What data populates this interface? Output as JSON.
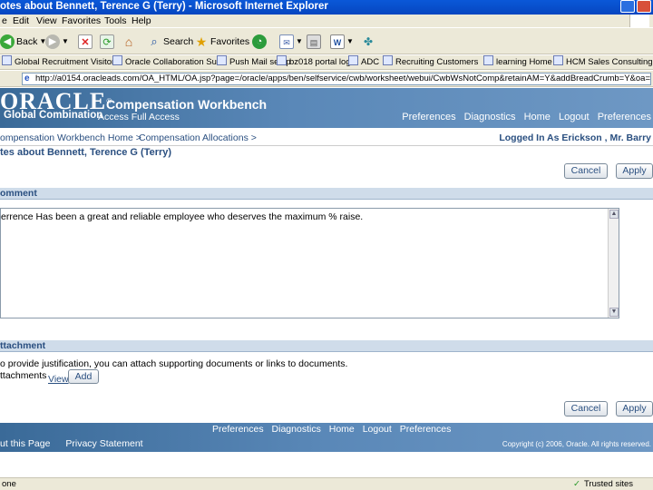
{
  "browser": {
    "title": "otes about Bennett, Terence G (Terry) - Microsoft Internet Explorer",
    "menu": [
      "e",
      "Edit",
      "View",
      "Favorites",
      "Tools",
      "Help"
    ],
    "toolbar": {
      "back": "Back",
      "search": "Search",
      "favorites": "Favorites"
    },
    "links": [
      "Global Recruitment Visitor",
      "Oracle Collaboration Suite",
      "Push Mail setup",
      "bz018 portal login",
      "ADC",
      "Recruiting Customers",
      "learning Home",
      "HCM Sales Consulting"
    ],
    "address": "http://a0154.oracleads.com/OA_HTML/OA.jsp?page=/oracle/apps/ben/selfservice/cwb/worksheet/webui/CwbWsNotComp&retainAM=Y&addBreadCrumb=Y&oa=",
    "status_left": "one",
    "status_right": "Trusted sites"
  },
  "header": {
    "logo": "ORACLE",
    "logo_mark": "®",
    "sub": "Global Combination",
    "app_name": "Compensation Workbench",
    "responsibility": "Access Full Access",
    "nav": [
      "Preferences",
      "Diagnostics",
      "Home",
      "Logout",
      "Preferences"
    ]
  },
  "breadcrumbs": [
    "ompensation Workbench Home  >",
    "Compensation Allocations  >"
  ],
  "logged_in": "Logged In As Erickson , Mr. Barry",
  "page_title": "tes about Bennett, Terence G (Terry)",
  "buttons": {
    "cancel": "Cancel",
    "apply": "Apply",
    "add": "Add"
  },
  "comment": {
    "heading": "omment",
    "text": "errence Has been a great and reliable employee who deserves the maximum % raise."
  },
  "attachment": {
    "heading": "ttachment",
    "help": "o provide justification, you can attach supporting documents or links to documents.",
    "label": "ttachments",
    "view": "View"
  },
  "footer": {
    "nav": [
      "Preferences",
      "Diagnostics",
      "Home",
      "Logout",
      "Preferences"
    ],
    "links": [
      "ut this Page",
      "Privacy Statement"
    ],
    "copyright": "Copyright (c) 2006, Oracle. All rights reserved."
  }
}
